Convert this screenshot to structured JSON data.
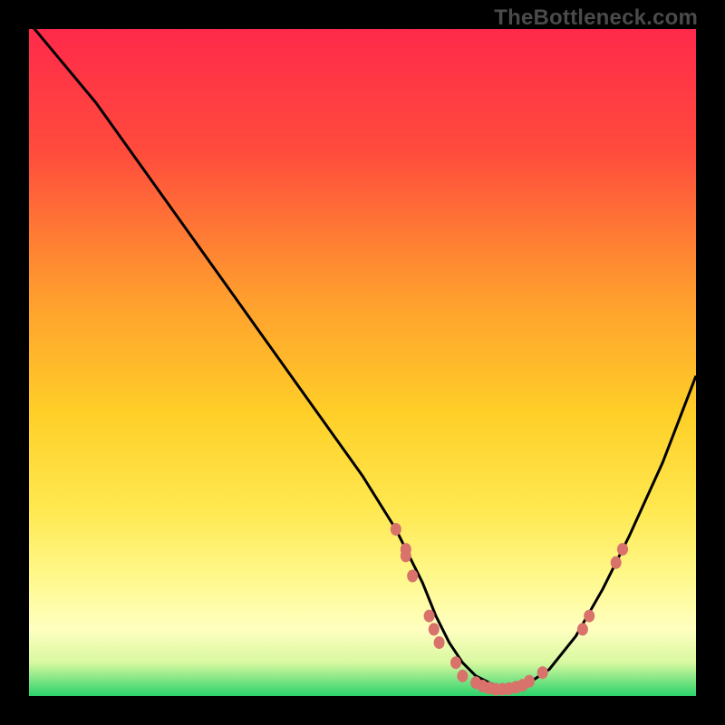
{
  "watermark": "TheBottleneck.com",
  "colors": {
    "background_outer": "#000000",
    "gradient_top": "#ff2a4a",
    "gradient_mid": "#ffd028",
    "gradient_low": "#ffffa8",
    "gradient_bottom": "#2bd36b",
    "curve_stroke": "#000000",
    "marker_fill": "#d8726b"
  },
  "chart_data": {
    "type": "line",
    "title": "",
    "xlabel": "",
    "ylabel": "",
    "xlim": [
      0,
      100
    ],
    "ylim": [
      0,
      100
    ],
    "series": [
      {
        "name": "curve",
        "x": [
          0,
          5,
          10,
          15,
          20,
          25,
          30,
          35,
          40,
          45,
          50,
          55,
          57,
          59,
          61,
          63,
          65,
          67,
          69,
          71,
          73,
          75,
          78,
          82,
          86,
          90,
          95,
          100
        ],
        "y": [
          101,
          95,
          89,
          82,
          75,
          68,
          61,
          54,
          47,
          40,
          33,
          25,
          21,
          17,
          12,
          8,
          5,
          3,
          2,
          1,
          1,
          2,
          4,
          9,
          16,
          24,
          35,
          48
        ]
      }
    ],
    "markers": [
      {
        "x": 55,
        "y": 25
      },
      {
        "x": 56.5,
        "y": 22
      },
      {
        "x": 56.5,
        "y": 21
      },
      {
        "x": 57.5,
        "y": 18
      },
      {
        "x": 60,
        "y": 12
      },
      {
        "x": 60.7,
        "y": 10
      },
      {
        "x": 61.5,
        "y": 8
      },
      {
        "x": 64,
        "y": 5
      },
      {
        "x": 65,
        "y": 3
      },
      {
        "x": 67,
        "y": 2
      },
      {
        "x": 68,
        "y": 1.5
      },
      {
        "x": 69,
        "y": 1.2
      },
      {
        "x": 70,
        "y": 1
      },
      {
        "x": 71,
        "y": 1
      },
      {
        "x": 72,
        "y": 1.1
      },
      {
        "x": 73,
        "y": 1.3
      },
      {
        "x": 74,
        "y": 1.6
      },
      {
        "x": 75,
        "y": 2.2
      },
      {
        "x": 77,
        "y": 3.5
      },
      {
        "x": 83,
        "y": 10
      },
      {
        "x": 84,
        "y": 12
      },
      {
        "x": 88,
        "y": 20
      },
      {
        "x": 89,
        "y": 22
      }
    ],
    "gradient_stops": [
      {
        "offset": 0,
        "color": "#ff2a4a"
      },
      {
        "offset": 0.18,
        "color": "#ff4a3d"
      },
      {
        "offset": 0.4,
        "color": "#ff9d2e"
      },
      {
        "offset": 0.58,
        "color": "#ffd028"
      },
      {
        "offset": 0.72,
        "color": "#ffe850"
      },
      {
        "offset": 0.82,
        "color": "#fff88a"
      },
      {
        "offset": 0.9,
        "color": "#ffffc0"
      },
      {
        "offset": 0.95,
        "color": "#d8f8a0"
      },
      {
        "offset": 1.0,
        "color": "#2bd36b"
      }
    ]
  }
}
